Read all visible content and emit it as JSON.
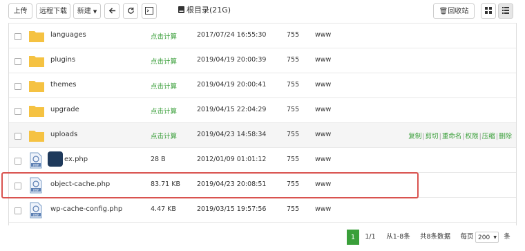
{
  "toolbar": {
    "upload_label": "上传",
    "remote_download_label": "远程下载",
    "new_label": "新建",
    "root_label": "根目录(21G)",
    "recycle_label": "回收站"
  },
  "files": [
    {
      "name": "languages",
      "size": "点击计算",
      "date": "2017/07/24 16:55:30",
      "perm": "755",
      "owner": "www",
      "type": "folder"
    },
    {
      "name": "plugins",
      "size": "点击计算",
      "date": "2019/04/19 20:00:39",
      "perm": "755",
      "owner": "www",
      "type": "folder"
    },
    {
      "name": "themes",
      "size": "点击计算",
      "date": "2019/04/19 20:00:41",
      "perm": "755",
      "owner": "www",
      "type": "folder"
    },
    {
      "name": "upgrade",
      "size": "点击计算",
      "date": "2019/04/15 22:04:29",
      "perm": "755",
      "owner": "www",
      "type": "folder"
    },
    {
      "name": "uploads",
      "size": "点击计算",
      "date": "2019/04/23 14:58:34",
      "perm": "755",
      "owner": "www",
      "type": "folder",
      "ops": [
        "复制",
        "剪切",
        "重命名",
        "权限",
        "压缩",
        "删除"
      ]
    },
    {
      "name": "ex.php",
      "size": "28 B",
      "date": "2012/01/09 01:01:12",
      "perm": "755",
      "owner": "www",
      "type": "php"
    },
    {
      "name": "object-cache.php",
      "size": "83.71 KB",
      "date": "2019/04/23 20:08:51",
      "perm": "755",
      "owner": "www",
      "type": "php"
    },
    {
      "name": "wp-cache-config.php",
      "size": "4.47 KB",
      "date": "2019/03/15 19:57:56",
      "perm": "755",
      "owner": "www",
      "type": "php"
    }
  ],
  "colors": {
    "link": "#3a9f3a",
    "highlight_box": "#d9534f",
    "folder": "#f5c242"
  },
  "pagination": {
    "current": "1",
    "page_info": "1/1",
    "range": "从1-8条",
    "total": "共8条数据",
    "per_page_label": "每页",
    "per_page_value": "200",
    "per_page_unit": "条"
  }
}
